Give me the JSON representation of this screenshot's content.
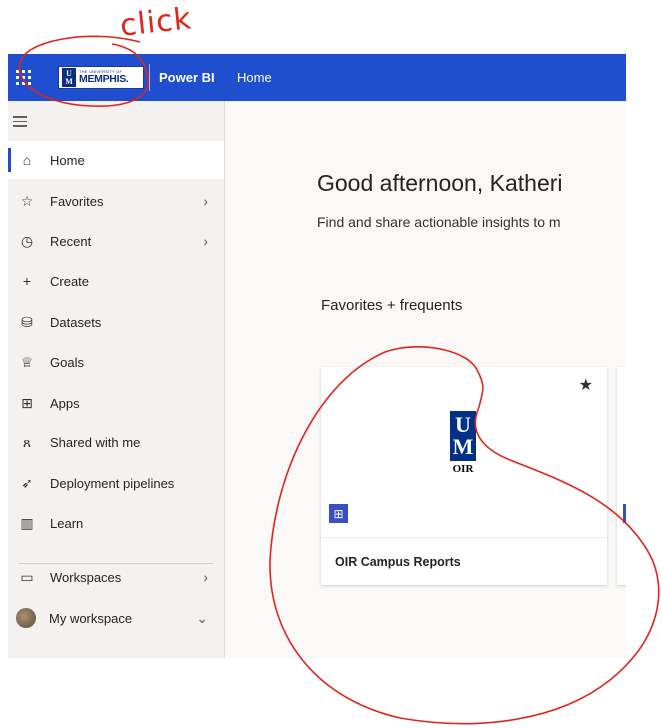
{
  "annotation": {
    "click_text": "click",
    "color": "#e2231a"
  },
  "topbar": {
    "logo": {
      "small": "THE UNIVERSITY OF",
      "big": "MEMPHIS.",
      "mark": "UM"
    },
    "app_name": "Power BI",
    "breadcrumb": "Home",
    "color": "#1f4fcf"
  },
  "sidebar": {
    "items": [
      {
        "label": "Home",
        "icon": "home-icon",
        "active": true
      },
      {
        "label": "Favorites",
        "icon": "star-icon",
        "chevron": "right"
      },
      {
        "label": "Recent",
        "icon": "clock-icon",
        "chevron": "right"
      },
      {
        "label": "Create",
        "icon": "plus-icon"
      },
      {
        "label": "Datasets",
        "icon": "database-icon"
      },
      {
        "label": "Goals",
        "icon": "trophy-icon"
      },
      {
        "label": "Apps",
        "icon": "apps-icon"
      },
      {
        "label": "Shared with me",
        "icon": "people-icon"
      },
      {
        "label": "Deployment pipelines",
        "icon": "rocket-icon"
      },
      {
        "label": "Learn",
        "icon": "book-icon"
      },
      {
        "label": "Workspaces",
        "icon": "workspaces-icon",
        "chevron": "right"
      },
      {
        "label": "My workspace",
        "icon": "avatar",
        "chevron": "down"
      }
    ]
  },
  "main": {
    "greeting": "Good afternoon, Katheri",
    "subtitle": "Find and share actionable insights to m",
    "section_title": "Favorites + frequents",
    "card": {
      "title": "OIR Campus Reports",
      "logo_mark": "UM",
      "logo_text": "OIR",
      "favorited": true
    }
  }
}
